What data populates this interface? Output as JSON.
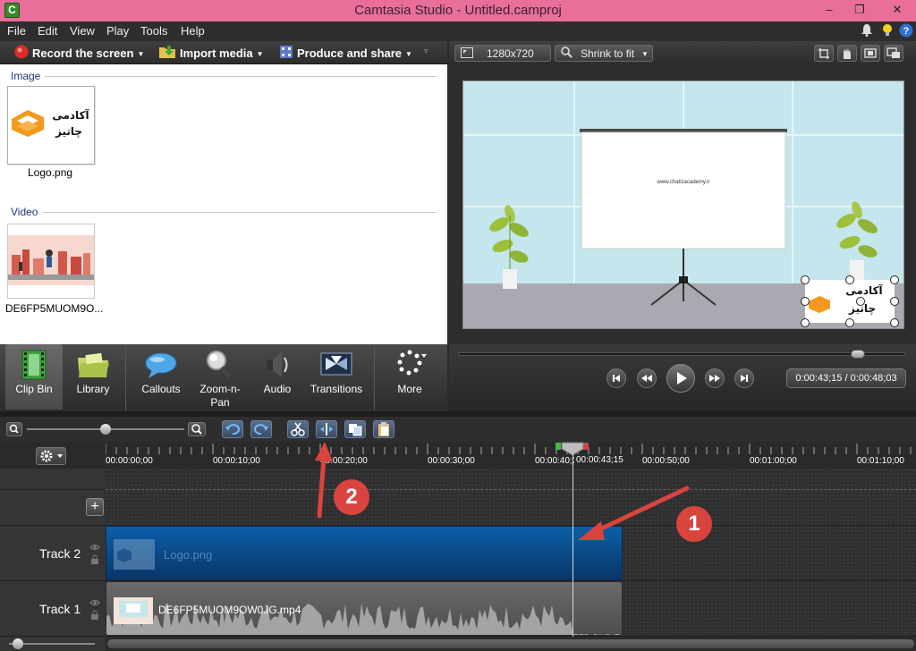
{
  "window": {
    "app_icon_letter": "C",
    "title": "Camtasia Studio - Untitled.camproj",
    "minimize": "–",
    "restore": "❐",
    "close": "✕"
  },
  "menu": {
    "items": [
      "File",
      "Edit",
      "View",
      "Play",
      "Tools",
      "Help"
    ],
    "icons": [
      "bell-icon",
      "lightbulb-icon",
      "help-icon"
    ]
  },
  "toolbar": {
    "record": "Record the screen",
    "import": "Import media",
    "produce": "Produce and share"
  },
  "clipbin": {
    "image_section": "Image",
    "video_section": "Video",
    "image_item": {
      "caption": "Logo.png",
      "logo_line1": "آکادمی",
      "logo_line2": "چاتیز"
    },
    "video_item": {
      "caption": "DE6FP5MUOM9O..."
    }
  },
  "tabs": [
    {
      "label": "Clip Bin",
      "icon": "film-icon"
    },
    {
      "label": "Library",
      "icon": "folder-icon"
    },
    {
      "label": "Callouts",
      "icon": "speech-bubble-icon"
    },
    {
      "label": "Zoom-n-\nPan",
      "icon": "magnifier-icon"
    },
    {
      "label": "Audio",
      "icon": "speaker-icon"
    },
    {
      "label": "Transitions",
      "icon": "transition-icon"
    },
    {
      "label": "More",
      "icon": "more-icon"
    }
  ],
  "preview": {
    "dimensions": "1280x720",
    "zoom": "Shrink to fit",
    "screen_url": "www.chatizacademy.ir",
    "overlay_line1": "آکادمی",
    "overlay_line2": "چاتیز",
    "time": "0:00:43;15 / 0:00:48;03",
    "scrub_fraction": 0.9
  },
  "timeline": {
    "ticks": [
      "00:00:00;00",
      "00:00:10;00",
      "00:00:20;00",
      "00:00:30;00",
      "00:00:40;00",
      "00:00:50;00",
      "00:01:00;00",
      "00:01:10;00"
    ],
    "playhead_time": "00:00:43;15",
    "tracks": [
      {
        "name": "Track 2",
        "clip": "Logo.png"
      },
      {
        "name": "Track 1",
        "clip": "DE6FP5MUOM9OW0JG.mp4"
      }
    ]
  },
  "annotations": {
    "callout1": "1",
    "callout2": "2"
  },
  "colors": {
    "titlebar": "#e96f9a",
    "accent_red": "#d9443f",
    "clip_blue": "#0b4a86"
  }
}
